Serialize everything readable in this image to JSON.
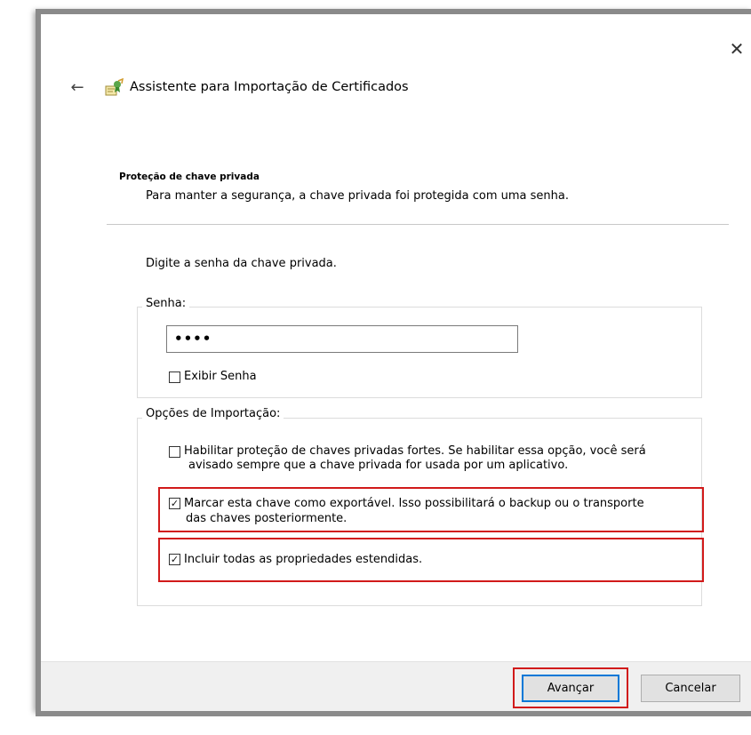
{
  "window": {
    "title": "Assistente para Importação de Certificados"
  },
  "section": {
    "heading": "Proteção de chave privada",
    "description": "Para manter a segurança, a chave privada foi protegida com uma senha."
  },
  "prompt": "Digite a senha da chave privada.",
  "password_group": {
    "legend": "Senha:",
    "value": "••••",
    "show_password_label": "Exibir Senha",
    "show_password_checked": false
  },
  "import_options": {
    "legend": "Opções de Importação:",
    "options": [
      {
        "line1": "Habilitar proteção de chaves privadas fortes. Se habilitar essa opção, você será",
        "line2": "avisado sempre que a chave privada for usada por um aplicativo.",
        "checked": false
      },
      {
        "line1": "Marcar esta chave como exportável. Isso possibilitará o backup ou o transporte",
        "line2": "das chaves posteriormente.",
        "checked": true
      },
      {
        "line1": "Incluir todas as propriedades estendidas.",
        "line2": "",
        "checked": true
      }
    ]
  },
  "buttons": {
    "next": "Avançar",
    "cancel": "Cancelar"
  },
  "glyphs": {
    "close": "✕",
    "back": "←",
    "check": "✓"
  },
  "colors": {
    "highlight": "#d11a1a",
    "primary_button_border": "#0078d7",
    "footer_bg": "#f0f0f0"
  }
}
